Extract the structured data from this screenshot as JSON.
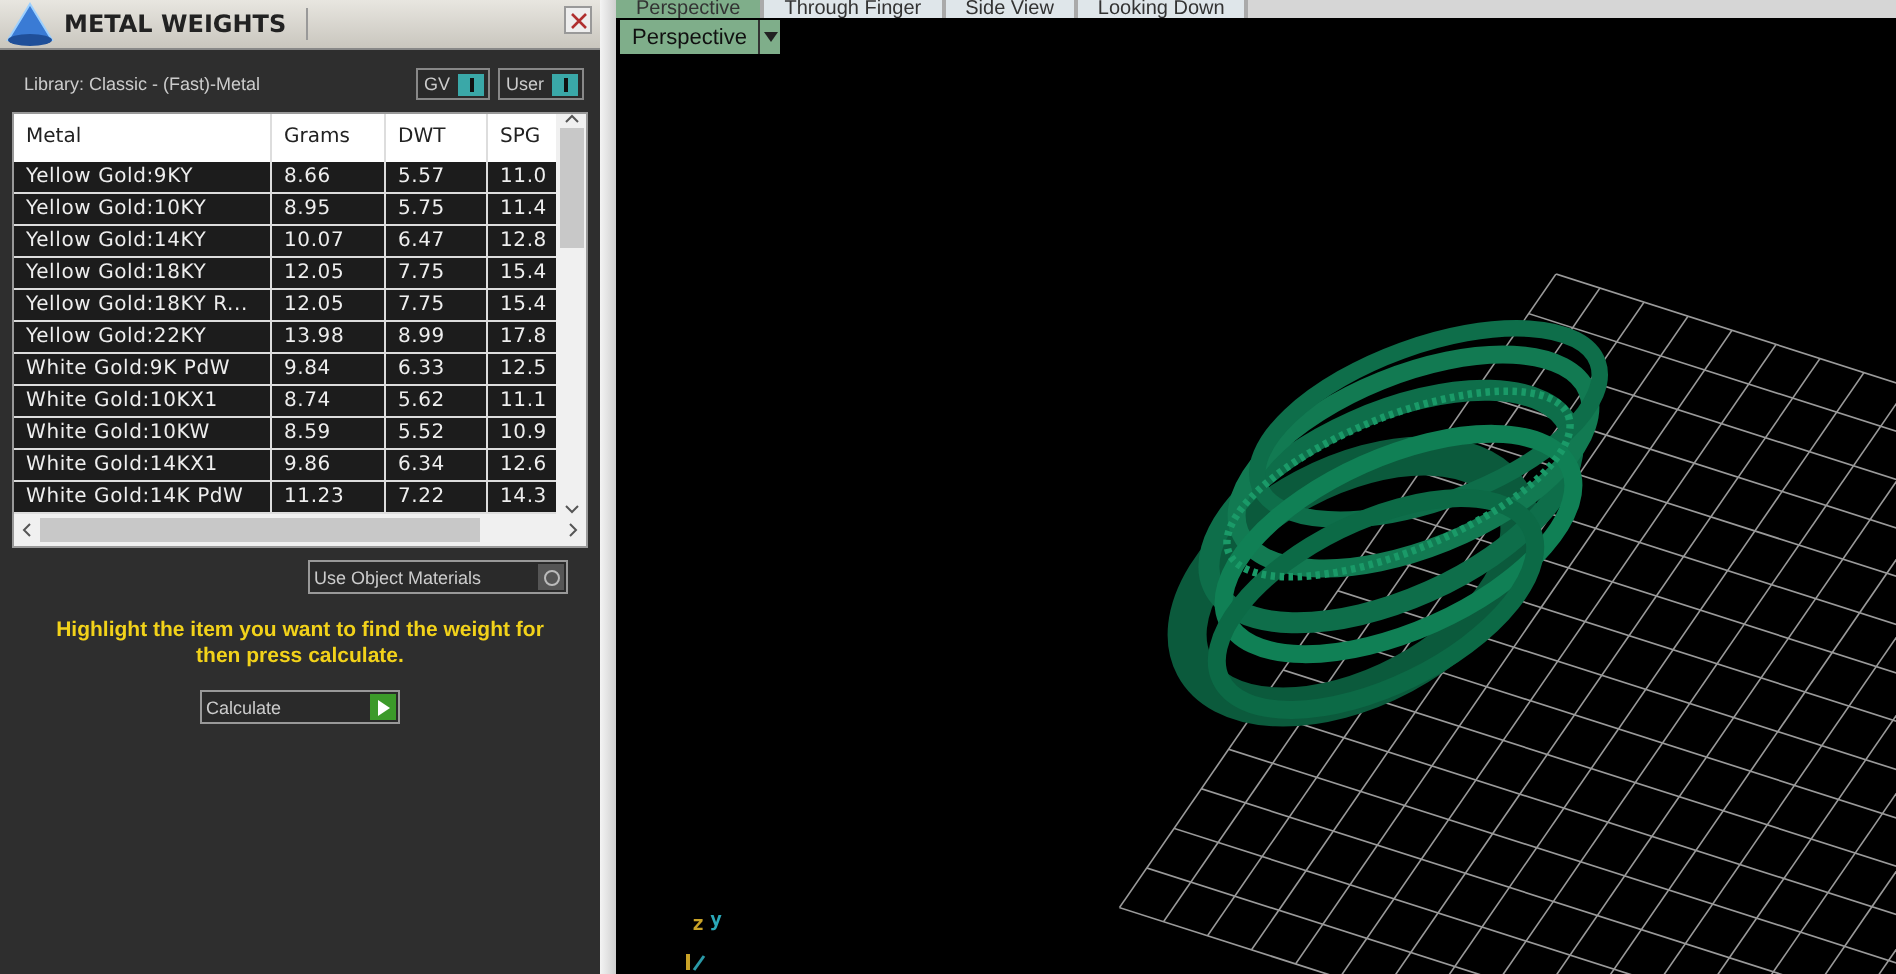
{
  "panel": {
    "title": "METAL WEIGHTS",
    "library": "Library: Classic - (Fast)-Metal",
    "toggles": [
      {
        "label": "GV",
        "on": true
      },
      {
        "label": "User",
        "on": true
      }
    ]
  },
  "table": {
    "columns": [
      "Metal",
      "Grams",
      "DWT",
      "SPG"
    ],
    "rows": [
      [
        "Yellow Gold:9KY",
        "8.66",
        "5.57",
        "11.0"
      ],
      [
        "Yellow Gold:10KY",
        "8.95",
        "5.75",
        "11.4"
      ],
      [
        "Yellow Gold:14KY",
        "10.07",
        "6.47",
        "12.8"
      ],
      [
        "Yellow Gold:18KY",
        "12.05",
        "7.75",
        "15.4"
      ],
      [
        "Yellow Gold:18KY R...",
        "12.05",
        "7.75",
        "15.4"
      ],
      [
        "Yellow Gold:22KY",
        "13.98",
        "8.99",
        "17.8"
      ],
      [
        "White Gold:9K PdW",
        "9.84",
        "6.33",
        "12.5"
      ],
      [
        "White Gold:10KX1",
        "8.74",
        "5.62",
        "11.1"
      ],
      [
        "White Gold:10KW",
        "8.59",
        "5.52",
        "10.9"
      ],
      [
        "White Gold:14KX1",
        "9.86",
        "6.34",
        "12.6"
      ],
      [
        "White Gold:14K PdW",
        "11.23",
        "7.22",
        "14.3"
      ]
    ]
  },
  "use_object_materials": {
    "label": "Use Object Materials",
    "checked": false
  },
  "hint": "Highlight the item you want to find the weight for then press calculate.",
  "calculate_button": "Calculate",
  "viewport": {
    "tabs": [
      {
        "label": "Perspective",
        "selected": true
      },
      {
        "label": "Through Finger",
        "selected": false
      },
      {
        "label": "Side View",
        "selected": false
      },
      {
        "label": "Looking Down",
        "selected": false
      }
    ],
    "view_menu": "Perspective",
    "axis_labels": [
      "z",
      "y"
    ]
  }
}
